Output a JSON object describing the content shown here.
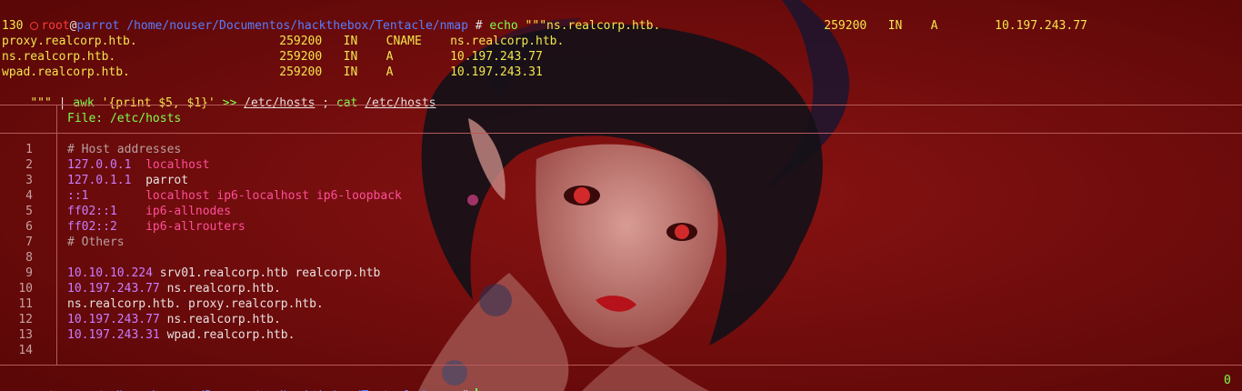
{
  "prompt": {
    "user": "root",
    "at": "@",
    "host": "parrot",
    "path": "/home/nouser/Documentos/hackthebox/Tentacle/nmap",
    "symbol": "#"
  },
  "command": {
    "line1_cmd": "echo",
    "line1_rest": " \"\"\"ns.realcorp.htb.                       259200   IN    A        10.197.243.77",
    "line2": "130",
    "records": [
      "proxy.realcorp.htb.                    259200   IN    CNAME    ns.realcorp.htb.",
      "ns.realcorp.htb.                       259200   IN    A        10.197.243.77",
      "wpad.realcorp.htb.                     259200   IN    A        10.197.243.31"
    ],
    "tail_quotes": "\"\"\"",
    "tail_pipe": " | ",
    "tail_awk": "awk",
    "tail_awk_arg": " '{print $5, $1}'",
    "tail_redirect": " >> ",
    "tail_file1": "/etc/hosts",
    "tail_sep": " ; ",
    "tail_cat": "cat",
    "tail_space": " ",
    "tail_file2": "/etc/hosts"
  },
  "file_header": "File: /etc/hosts",
  "file_lines": [
    {
      "n": "1",
      "a": "# Host addresses",
      "b": ""
    },
    {
      "n": "2",
      "a": "127.0.0.1",
      "b": "  localhost"
    },
    {
      "n": "3",
      "a": "127.0.1.1",
      "b": "  parrot"
    },
    {
      "n": "4",
      "a": "::1",
      "b": "        localhost ip6-localhost ip6-loopback"
    },
    {
      "n": "5",
      "a": "ff02::1",
      "b": "    ip6-allnodes"
    },
    {
      "n": "6",
      "a": "ff02::2",
      "b": "    ip6-allrouters"
    },
    {
      "n": "7",
      "a": "# Others",
      "b": ""
    },
    {
      "n": "8",
      "a": "",
      "b": ""
    },
    {
      "n": "9",
      "a": "10.10.10.224",
      "b": " srv01.realcorp.htb realcorp.htb"
    },
    {
      "n": "10",
      "a": "10.197.243.77",
      "b": " ns.realcorp.htb."
    },
    {
      "n": "11",
      "a": "",
      "b": "ns.realcorp.htb. proxy.realcorp.htb."
    },
    {
      "n": "12",
      "a": "10.197.243.77",
      "b": " ns.realcorp.htb."
    },
    {
      "n": "13",
      "a": "10.197.243.31",
      "b": " wpad.realcorp.htb."
    },
    {
      "n": "14",
      "a": "",
      "b": ""
    }
  ],
  "status_right": "0",
  "colors": {
    "background": "#6e0b0b",
    "prompt_user": "#ff3b3b",
    "prompt_path": "#5a7dff",
    "output": "#f2e64d",
    "command": "#7dff4a",
    "ip": "#c77dff",
    "hostname_alias": "#ff4f9a",
    "comment": "#b7a0a0"
  }
}
